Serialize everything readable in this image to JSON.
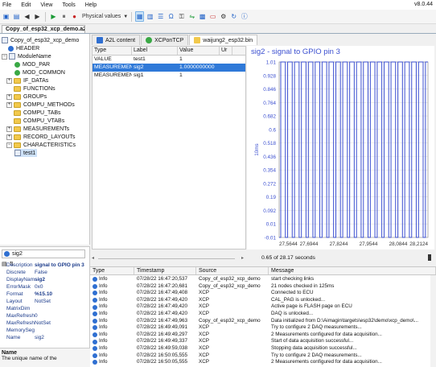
{
  "menu": {
    "items": [
      "File",
      "Edit",
      "View",
      "Tools",
      "Help"
    ],
    "version": "v8.0.44"
  },
  "toolbar": {
    "mode_label": "Physical values"
  },
  "document_tab": "Copy_of_esp32_xcp_demo.a2l",
  "tree": {
    "root": "Copy_of_esp32_xcp_demo",
    "header": "HEADER",
    "module": "ModuleName",
    "mod_par": "MOD_PAR",
    "mod_common": "MOD_COMMON",
    "if_datas": "IF_DATAs",
    "functions": "FUNCTIONs",
    "groups": "GROUPs",
    "compu_methods": "COMPU_METHODs",
    "compu_tabs": "COMPU_TABs",
    "compu_vtabs": "COMPU_VTABs",
    "measurements": "MEASUREMENTs",
    "record_layouts": "RECORD_LAYOUTs",
    "characteristics": "CHARACTERISTICs",
    "test1": "test1"
  },
  "properties": {
    "selected": "sig2",
    "rows": [
      {
        "key": "Description",
        "value": "signal to GPIO pin 3"
      },
      {
        "key": "Discrete",
        "value": "False"
      },
      {
        "key": "DisplayName",
        "value": "sig2"
      },
      {
        "key": "ErrorMask",
        "value": "0x0"
      },
      {
        "key": "Format",
        "value": "%15.10"
      },
      {
        "key": "Layout",
        "value": "NotSet"
      },
      {
        "key": "MatrixDim",
        "value": ""
      },
      {
        "key": "MaxRefreshI",
        "value": "0"
      },
      {
        "key": "MaxRefreshI",
        "value": "NotSet"
      },
      {
        "key": "MemorySegi",
        "value": ""
      },
      {
        "key": "Name",
        "value": "sig2"
      }
    ],
    "desc_title": "Name",
    "desc_text": "The unique name of the"
  },
  "subtabs": [
    "A2L content",
    "XCPonTCP",
    "waijung2_esp32.bin"
  ],
  "signal_table": {
    "headers": [
      "Type",
      "Label",
      "Value",
      "Ur"
    ],
    "rows": [
      {
        "type": "VALUE",
        "label": "test1",
        "value": "1"
      },
      {
        "type": "MEASUREMENT",
        "label": "sig2",
        "value": "1.0000000000"
      },
      {
        "type": "MEASUREMENT",
        "label": "sig1",
        "value": "1"
      }
    ]
  },
  "chart_data": {
    "type": "line",
    "title": "sig2 - signal to GPIO pin 3",
    "ylabel": "10ms",
    "xlim": [
      27.5644,
      28.2124
    ],
    "ylim": [
      -0.01,
      1.01
    ],
    "x_ticks": [
      "27,5644",
      "27,6944",
      "27,8244",
      "27,9544",
      "28,0844",
      "28,2124"
    ],
    "y_ticks": [
      "1.01",
      "0.928",
      "0.846",
      "0.764",
      "0.682",
      "0.6",
      "0.518",
      "0.436",
      "0.354",
      "0.272",
      "0.19",
      "0.092",
      "0.01",
      "-0.01"
    ],
    "series": [
      {
        "values_description": "square wave",
        "x": [
          27.5644,
          27.5714,
          27.5714,
          27.5914,
          27.5914,
          27.6014,
          27.6014,
          27.6214,
          27.6214,
          27.6314,
          27.6314,
          27.6514,
          27.6514,
          27.6614,
          27.6614,
          27.6814,
          27.6814,
          27.6914,
          27.6914,
          27.7114,
          27.7114,
          27.7214,
          27.7214,
          27.7414,
          27.7414,
          27.7514,
          27.7514,
          27.7714,
          27.7714,
          27.7814,
          27.7814,
          27.8014,
          27.8014,
          27.8114,
          27.8114,
          27.8314,
          27.8314,
          27.8414,
          27.8414,
          27.8614,
          27.8614,
          27.8714,
          27.8714,
          27.8914,
          27.8914,
          27.9014,
          27.9014,
          27.9214,
          27.9214,
          27.9314,
          27.9314,
          27.9514,
          27.9514,
          27.9614,
          27.9614,
          27.9814,
          27.9814,
          27.9914,
          27.9914,
          28.0114,
          28.0114,
          28.0214,
          28.0214,
          28.0414,
          28.0414,
          28.0514,
          28.0514,
          28.0714,
          28.0714,
          28.0814,
          28.0814,
          28.1014,
          28.1014,
          28.1114,
          28.1114,
          28.1314,
          28.1314,
          28.1414,
          28.1414,
          28.1614,
          28.1614,
          28.1714,
          28.1714,
          28.1914,
          28.1914,
          28.2014,
          28.2014,
          28.2124
        ],
        "values": [
          -0.01,
          -0.01,
          1.01,
          1.01,
          -0.01,
          -0.01,
          1.01,
          1.01,
          -0.01,
          -0.01,
          1.01,
          1.01,
          -0.01,
          -0.01,
          1.01,
          1.01,
          -0.01,
          -0.01,
          1.01,
          1.01,
          -0.01,
          -0.01,
          1.01,
          1.01,
          -0.01,
          -0.01,
          1.01,
          1.01,
          -0.01,
          -0.01,
          1.01,
          1.01,
          -0.01,
          -0.01,
          1.01,
          1.01,
          -0.01,
          -0.01,
          1.01,
          1.01,
          -0.01,
          -0.01,
          1.01,
          1.01,
          -0.01,
          -0.01,
          1.01,
          1.01,
          -0.01,
          -0.01,
          1.01,
          1.01,
          -0.01,
          -0.01,
          1.01,
          1.01,
          -0.01,
          -0.01,
          1.01,
          1.01,
          -0.01,
          -0.01,
          1.01,
          1.01,
          -0.01,
          -0.01,
          1.01,
          1.01,
          -0.01,
          -0.01,
          1.01,
          1.01,
          -0.01,
          -0.01,
          1.01,
          1.01,
          -0.01,
          -0.01,
          1.01,
          1.01,
          -0.01,
          -0.01,
          1.01,
          1.01,
          -0.01,
          -0.01,
          1.01,
          1.01
        ]
      }
    ],
    "color": "#3b4fd0",
    "grid": true
  },
  "caption": "0.65 of 28.17 seconds",
  "log": {
    "headers": [
      "Type",
      "Timestamp",
      "Source",
      "Message"
    ],
    "rows": [
      {
        "type": "Info",
        "ts": "07/28/22 16:47:20,537",
        "src": "Copy_of_esp32_xcp_demo",
        "msg": "start checking links"
      },
      {
        "type": "Info",
        "ts": "07/28/22 16:47:20,681",
        "src": "Copy_of_esp32_xcp_demo",
        "msg": "21 nodes checked in 125ms"
      },
      {
        "type": "Info",
        "ts": "07/28/22 16:47:49,408",
        "src": "XCP",
        "msg": "Connected to ECU"
      },
      {
        "type": "Info",
        "ts": "07/28/22 16:47:49,420",
        "src": "XCP",
        "msg": "CAL_PAG is unlocked..."
      },
      {
        "type": "Info",
        "ts": "07/28/22 16:47:49,420",
        "src": "XCP",
        "msg": "Active page is FLASH page on ECU"
      },
      {
        "type": "Info",
        "ts": "07/28/22 16:47:49,420",
        "src": "XCP",
        "msg": "DAQ is unlocked..."
      },
      {
        "type": "Info",
        "ts": "07/28/22 16:47:49,963",
        "src": "Copy_of_esp32_xcp_demo",
        "msg": "Data initialized from D:\\Aimagin\\targets\\esp32\\demo\\xcp_demo\\..."
      },
      {
        "type": "Info",
        "ts": "07/28/22 16:49:49,091",
        "src": "XCP",
        "msg": "Try to configure 2 DAQ measurements..."
      },
      {
        "type": "Info",
        "ts": "07/28/22 16:49:49,297",
        "src": "XCP",
        "msg": "2 Measurements configured for data acquisition..."
      },
      {
        "type": "Info",
        "ts": "07/28/22 16:49:49,337",
        "src": "XCP",
        "msg": "Start of data acquisition successful..."
      },
      {
        "type": "Info",
        "ts": "07/28/22 16:49:59,038",
        "src": "XCP",
        "msg": "Stopping data acquisition successful..."
      },
      {
        "type": "Info",
        "ts": "07/28/22 16:50:05,555",
        "src": "XCP",
        "msg": "Try to configure 2 DAQ measurements..."
      },
      {
        "type": "Info",
        "ts": "07/28/22 16:50:05,555",
        "src": "XCP",
        "msg": "2 Measurements configured for data acquisition..."
      }
    ]
  }
}
